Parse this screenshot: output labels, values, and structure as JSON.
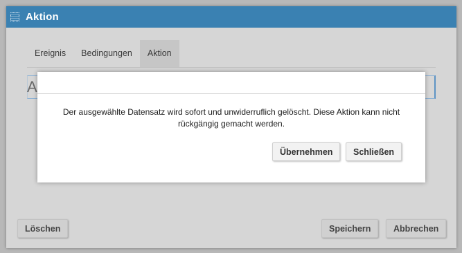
{
  "window": {
    "title": "Aktion",
    "titlebar_color": "#3a81b2"
  },
  "tabs": [
    {
      "label": "Ereignis",
      "active": false
    },
    {
      "label": "Bedingungen",
      "active": false
    },
    {
      "label": "Aktion",
      "active": true
    }
  ],
  "background_field": {
    "value": "A"
  },
  "footer": {
    "delete_label": "Löschen",
    "save_label": "Speichern",
    "cancel_label": "Abbrechen"
  },
  "dialog": {
    "message": "Der ausgewählte Datensatz wird sofort und unwiderruflich gelöscht. Diese Aktion kann nicht rückgängig gemacht werden.",
    "apply_label": "Übernehmen",
    "close_label": "Schließen"
  }
}
